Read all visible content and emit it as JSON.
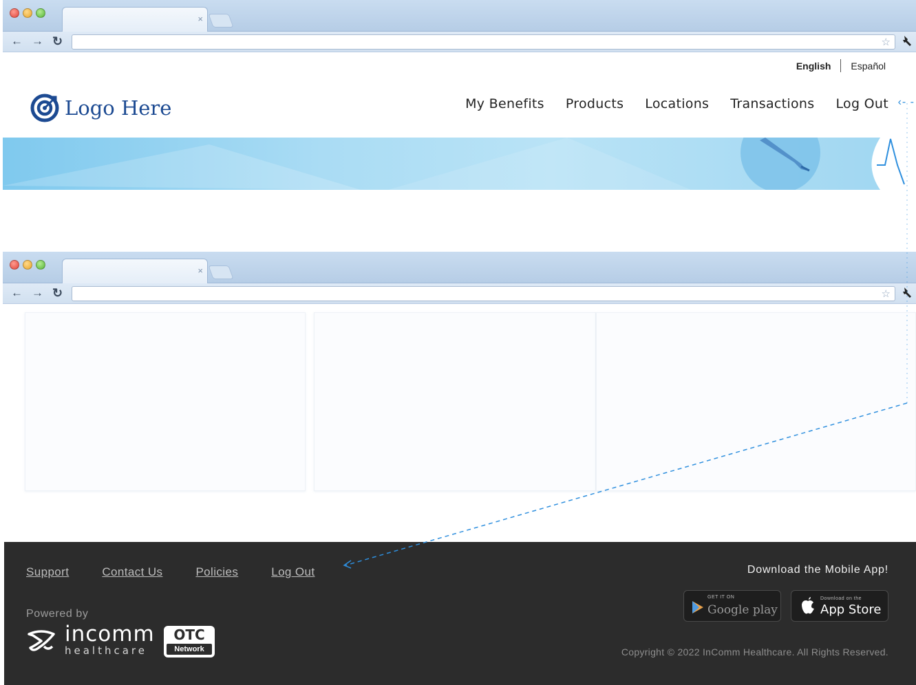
{
  "top_window": {
    "language": {
      "english": "English",
      "spanish": "Español"
    },
    "logo_text": "Logo Here",
    "nav": [
      "My Benefits",
      "Products",
      "Locations",
      "Transactions",
      "Log Out"
    ]
  },
  "bottom_window": {
    "footer": {
      "links": [
        "Support",
        "Contact Us",
        "Policies",
        "Log Out"
      ],
      "powered_by": "Powered by",
      "incomm_word": "incomm",
      "incomm_sub": "healthcare",
      "otc_top": "OTC",
      "otc_bottom": "Network",
      "download_title": "Download the Mobile App!",
      "google_play": {
        "small": "GET IT ON",
        "big": "Google play"
      },
      "app_store": {
        "small": "Download on the",
        "big": "App Store"
      },
      "copyright": "Copyright © 2022 InComm Healthcare. All Rights Reserved."
    }
  },
  "colors": {
    "brand_blue": "#1c4a92",
    "callout_blue": "#2e8fde",
    "footer_bg": "#2c2c2c",
    "hero_blue": "#9fd6f1"
  },
  "icons": [
    "close-icon",
    "back-arrow-icon",
    "forward-arrow-icon",
    "reload-icon",
    "star-icon",
    "wrench-icon",
    "target-logo-icon",
    "google-play-icon",
    "apple-icon",
    "incomm-logo-icon"
  ]
}
